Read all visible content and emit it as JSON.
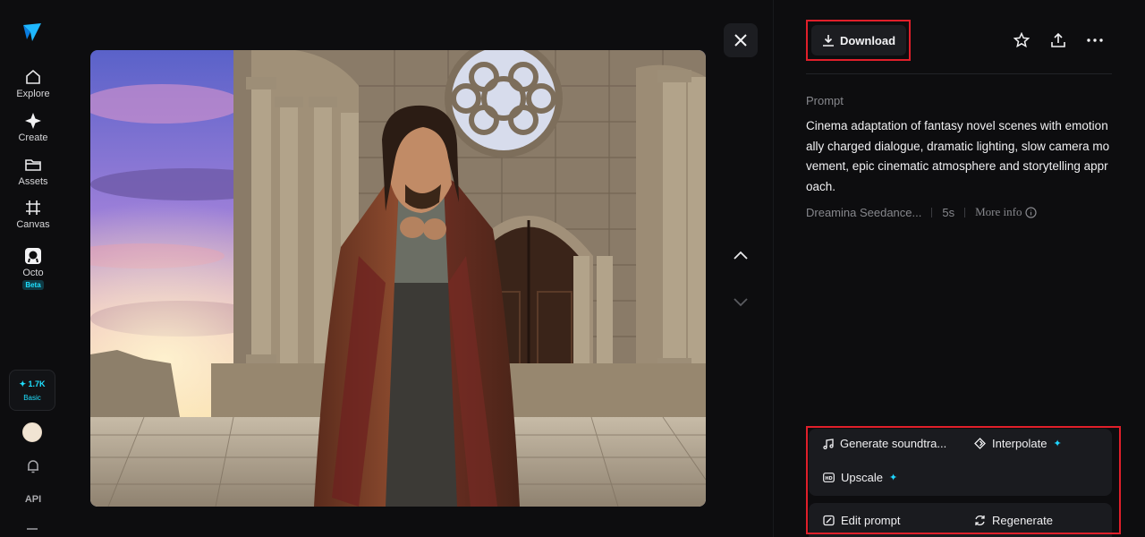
{
  "sidebar": {
    "items": [
      {
        "label": "Explore",
        "icon": "home-icon"
      },
      {
        "label": "Create",
        "icon": "sparkle-icon"
      },
      {
        "label": "Assets",
        "icon": "folder-icon"
      },
      {
        "label": "Canvas",
        "icon": "canvas-icon"
      },
      {
        "label": "Octo",
        "icon": "octo-icon",
        "badge": "Beta"
      }
    ],
    "credits": {
      "value": "1.7K",
      "plan": "Basic"
    },
    "api_label": "API"
  },
  "panel": {
    "download_label": "Download",
    "prompt_label": "Prompt",
    "prompt_text": "Cinema adaptation of fantasy novel scenes with emotionally charged dialogue, dramatic lighting, slow camera movement, epic cinematic atmosphere and storytelling approach.",
    "model": "Dreamina Seedance...",
    "duration": "5s",
    "more_info": "More info",
    "actions": {
      "soundtrack": "Generate soundtra...",
      "interpolate": "Interpolate",
      "upscale": "Upscale",
      "edit_prompt": "Edit prompt",
      "regenerate": "Regenerate"
    }
  },
  "colors": {
    "accent": "#1fe0ff",
    "highlight": "#e01f2a",
    "background": "#0d0d0f"
  }
}
